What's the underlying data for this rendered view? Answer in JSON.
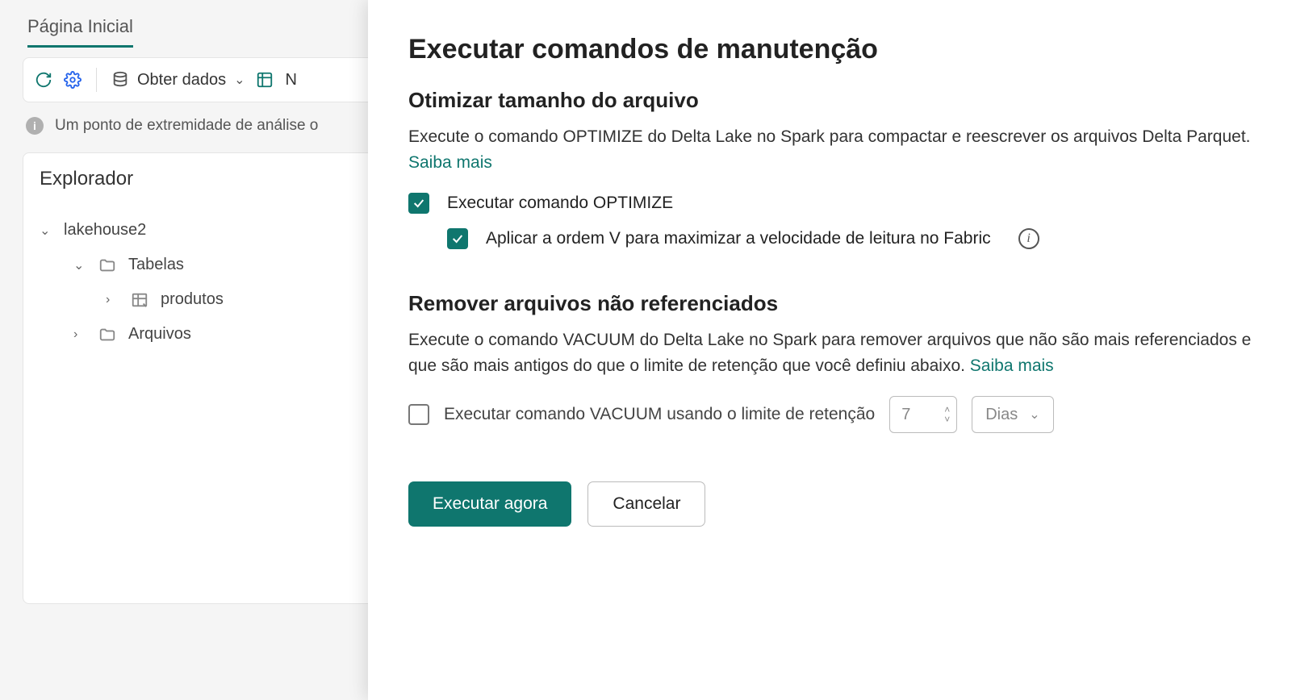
{
  "tab": "Página Inicial",
  "toolbar": {
    "getData": "Obter dados",
    "nextChar": "N"
  },
  "infoBar": "Um ponto de extremidade de análise o",
  "explorer": {
    "title": "Explorador",
    "root": "lakehouse2",
    "tables": "Tabelas",
    "product": "produtos",
    "files": "Arquivos"
  },
  "panel": {
    "title": "Executar comandos de manutenção",
    "sec1": {
      "heading": "Otimizar tamanho do arquivo",
      "desc": "Execute o comando OPTIMIZE do Delta Lake no Spark para compactar e reescrever os arquivos Delta Parquet. ",
      "learn": "Saiba mais",
      "opt1": "Executar comando OPTIMIZE",
      "opt2": "Aplicar a ordem V para maximizar a velocidade de leitura no Fabric"
    },
    "sec2": {
      "heading": "Remover arquivos não referenciados",
      "desc": "Execute o comando VACUUM do Delta Lake no Spark para remover arquivos que não são mais referenciados e que são mais antigos do que o limite de retenção que você definiu abaixo. ",
      "learn": "Saiba mais",
      "opt1": "Executar comando VACUUM usando o limite de retenção",
      "retentionValue": "7",
      "retentionUnit": "Dias"
    },
    "buttons": {
      "run": "Executar agora",
      "cancel": "Cancelar"
    }
  }
}
